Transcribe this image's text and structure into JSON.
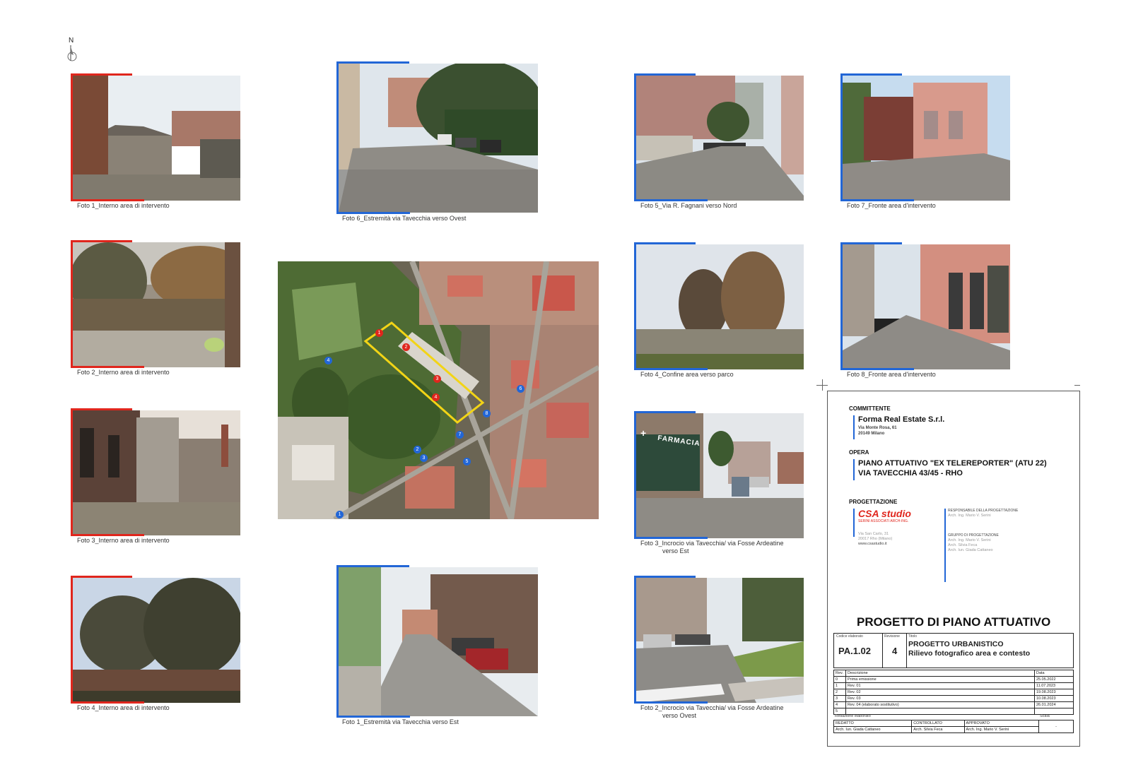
{
  "north_label": "N",
  "captions": {
    "foto1_interno": "Foto 1_Interno area di intervento",
    "foto2_interno": "Foto 2_Interno area di intervento",
    "foto3_interno": "Foto 3_Interno area di intervento",
    "foto4_interno": "Foto 4_Interno area di intervento",
    "foto6_estremita": "Foto 6_Estremità via Tavecchia verso Ovest",
    "foto1_estremita": "Foto 1_Estremità via Tavecchia verso Est",
    "foto5_fagnani": "Foto 5_Via R. Fagnani verso Nord",
    "foto4_confine": "Foto 4_Confine area verso parco",
    "foto3_incrocio_l1": "Foto 3_Incrocio via Tavecchia/ via Fosse Ardeatine",
    "foto3_incrocio_l2": "verso Est",
    "foto2_incrocio_l1": "Foto 2_Incrocio via Tavecchia/ via Fosse Ardeatine",
    "foto2_incrocio_l2": "verso Ovest",
    "foto7_fronte": "Foto 7_Fronte area d'intervento",
    "foto8_fronte": "Foto 8_Fronte area d'intervento"
  },
  "map_markers": {
    "red": [
      "1",
      "2",
      "3",
      "4"
    ],
    "blue": [
      "1",
      "2",
      "3",
      "4",
      "5",
      "6",
      "7",
      "8"
    ]
  },
  "shop_sign": "FARMACIA",
  "title_block": {
    "committente_label": "COMMITTENTE",
    "committente_name": "Forma Real Estate S.r.l.",
    "committente_addr1": "Via Monte Rosa, 61",
    "committente_addr2": "20149 Milano",
    "opera_label": "OPERA",
    "opera_line1": "PIANO ATTUATIVO \"EX TELEREPORTER\" (ATU 22)",
    "opera_line2": "VIA TAVECCHIA 43/45 - RHO",
    "progettazione_label": "PROGETTAZIONE",
    "studio_logo": "CSA studio",
    "studio_sub": "SERINI ASSOCIATI ARCH-ING.",
    "studio_addr1": "Via San Carlo, 31",
    "studio_addr2": "20017 Rho (Milano)",
    "studio_web": "www.csastudio.it",
    "resp_label": "RESPONSABILE DELLA PROGETTAZIONE",
    "resp_name": "Arch. Ing. Mario V. Serini",
    "gruppo_label": "GRUPPO DI PROGETTAZIONE",
    "gruppo_1": "Arch. Ing. Mario V. Serini",
    "gruppo_2": "Arch. Silvia Feca",
    "gruppo_3": "Arch. Iun. Giada Cattaneo",
    "main_title": "PROGETTO DI PIANO ATTUATIVO",
    "codice_label": "Codice elaborato",
    "codice": "PA.1.02",
    "revisione_label": "Revisione",
    "revisione": "4",
    "titolo_label": "Titolo",
    "titolo_1": "PROGETTO URBANISTICO",
    "titolo_2": "Rilievo fotografico area e contesto",
    "rev_header": [
      "Rev.",
      "Descrizione",
      "Data"
    ],
    "revisions": [
      [
        "0",
        "Prima emissione",
        "25.05.2022"
      ],
      [
        "1",
        "Rev. 01",
        "11.07.2023"
      ],
      [
        "2",
        "Rev. 02",
        "19.08.2023"
      ],
      [
        "3",
        "Rev. 03",
        "10.08.2023"
      ],
      [
        "4",
        "Rev. 04 (elaborato sostitutivo)",
        "26.01.2024"
      ],
      [
        "5",
        "",
        ""
      ]
    ],
    "redazione_label": "Redazione elaborato",
    "scala_label": "Scala",
    "redatto_label": "REDATTO",
    "controllato_label": "CONTROLLATO",
    "approvato_label": "APPROVATO",
    "redatto": "Arch. Iun. Giada Cattaneo",
    "controllato": "Arch. Silvia Feca",
    "approvato": "Arch. Ing. Mario V. Serini",
    "scala": "-"
  },
  "colors": {
    "interno_frame": "#e0261d",
    "esterno_frame": "#2266d6",
    "perimetro": "#f2d416"
  }
}
